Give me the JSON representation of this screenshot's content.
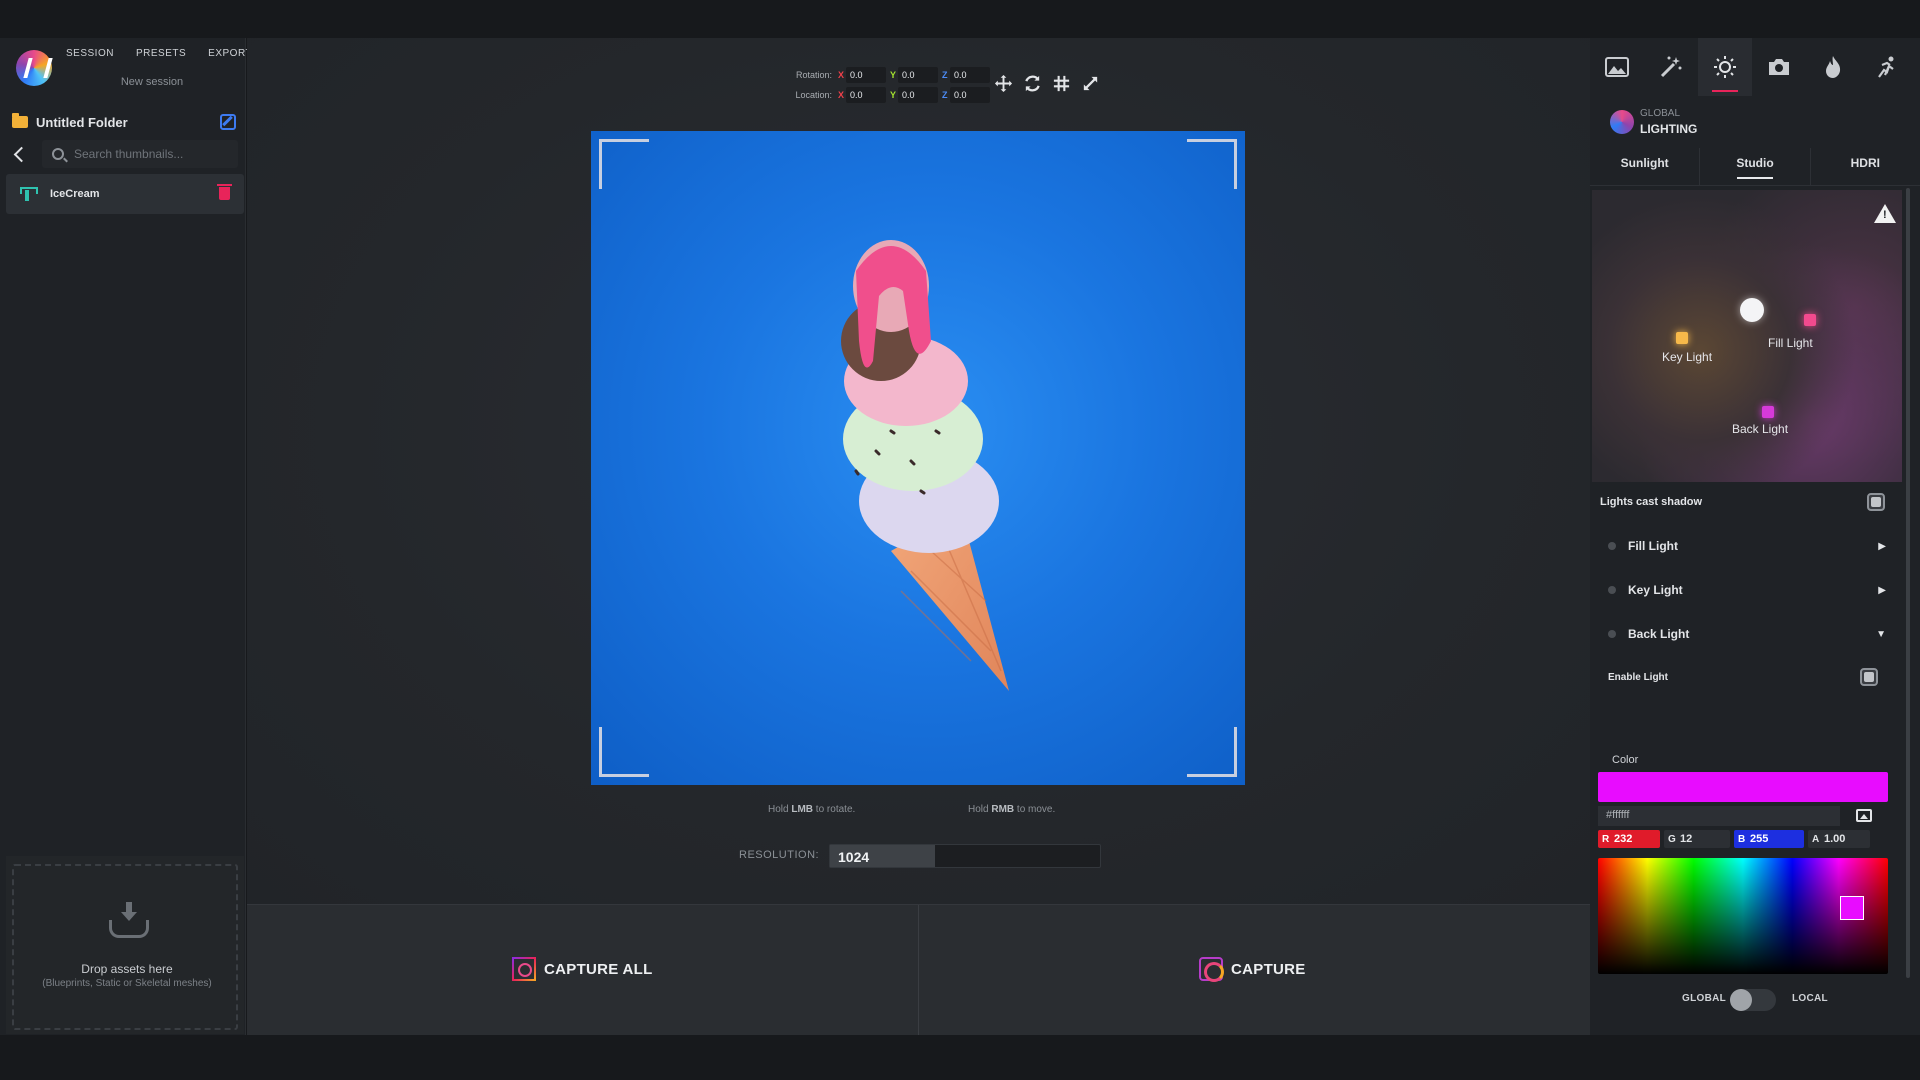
{
  "header": {
    "nav": [
      "SESSION",
      "PRESETS",
      "EXPORT"
    ],
    "session_name": "New session"
  },
  "sidebar": {
    "folder_name": "Untitled Folder",
    "search_placeholder": "Search thumbnails...",
    "items": [
      {
        "name": "IceCream",
        "icon": "blueprint-icon"
      }
    ],
    "dropzone": {
      "title": "Drop assets here",
      "subtitle": "(Blueprints, Static or Skeletal meshes)"
    }
  },
  "transform": {
    "rotation_label": "Rotation:",
    "location_label": "Location:",
    "axis_labels": [
      "X",
      "Y",
      "Z"
    ],
    "rotation": [
      "0.0",
      "0.0",
      "0.0"
    ],
    "location": [
      "0.0",
      "0.0",
      "0.0"
    ]
  },
  "viewport_tools": [
    "move-icon",
    "refresh-icon",
    "grid-icon",
    "fullscreen-icon"
  ],
  "hints": {
    "rotate": {
      "pre": "Hold ",
      "key": "LMB",
      "post": " to rotate."
    },
    "move": {
      "pre": "Hold ",
      "key": "RMB",
      "post": " to move."
    }
  },
  "resolution": {
    "label": "RESOLUTION:",
    "value": "1024",
    "fill_fraction": 0.39
  },
  "capture": {
    "all_label": "CAPTURE ALL",
    "single_label": "CAPTURE"
  },
  "right_panel": {
    "tool_tabs": [
      "image-icon",
      "magic-wand-icon",
      "sun-icon",
      "camera-icon",
      "flame-icon",
      "run-icon"
    ],
    "active_tool": 2,
    "section_small": "GLOBAL",
    "section_title": "LIGHTING",
    "light_tabs": [
      "Sunlight",
      "Studio",
      "HDRI"
    ],
    "active_light_tab": 1,
    "light_map_labels": {
      "key": "Key Light",
      "fill": "Fill Light",
      "back": "Back Light"
    },
    "lights_cast_shadow_label": "Lights cast shadow",
    "accordion": [
      {
        "label": "Fill Light",
        "arrow": "▶"
      },
      {
        "label": "Key Light",
        "arrow": "▶"
      },
      {
        "label": "Back Light",
        "arrow": "▼"
      }
    ],
    "enable_light_label": "Enable Light",
    "color_label": "Color",
    "color_swatch": "#e80cff",
    "hex_value": "#ffffff",
    "channels": {
      "r": "232",
      "g": "12",
      "b": "255",
      "a": "1.00"
    },
    "channel_keys": {
      "r": "R",
      "g": "G",
      "b": "B",
      "a": "A"
    },
    "scope": {
      "global": "GLOBAL",
      "local": "LOCAL"
    }
  },
  "colors": {
    "accent": "#e8245a",
    "axis_x": "#f0404a",
    "axis_y": "#a3e12f",
    "axis_z": "#4c8bf5",
    "viewport_bg": "#1a75e0"
  }
}
